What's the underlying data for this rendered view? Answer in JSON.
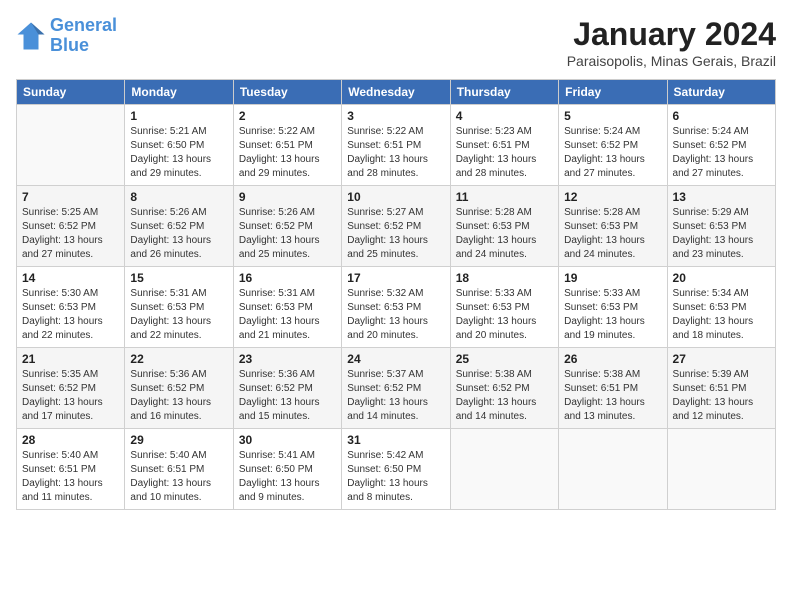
{
  "header": {
    "logo_line1": "General",
    "logo_line2": "Blue",
    "month": "January 2024",
    "location": "Paraisopolis, Minas Gerais, Brazil"
  },
  "weekdays": [
    "Sunday",
    "Monday",
    "Tuesday",
    "Wednesday",
    "Thursday",
    "Friday",
    "Saturday"
  ],
  "weeks": [
    [
      {
        "num": "",
        "empty": true
      },
      {
        "num": "1",
        "sunrise": "Sunrise: 5:21 AM",
        "sunset": "Sunset: 6:50 PM",
        "daylight": "Daylight: 13 hours and 29 minutes."
      },
      {
        "num": "2",
        "sunrise": "Sunrise: 5:22 AM",
        "sunset": "Sunset: 6:51 PM",
        "daylight": "Daylight: 13 hours and 29 minutes."
      },
      {
        "num": "3",
        "sunrise": "Sunrise: 5:22 AM",
        "sunset": "Sunset: 6:51 PM",
        "daylight": "Daylight: 13 hours and 28 minutes."
      },
      {
        "num": "4",
        "sunrise": "Sunrise: 5:23 AM",
        "sunset": "Sunset: 6:51 PM",
        "daylight": "Daylight: 13 hours and 28 minutes."
      },
      {
        "num": "5",
        "sunrise": "Sunrise: 5:24 AM",
        "sunset": "Sunset: 6:52 PM",
        "daylight": "Daylight: 13 hours and 27 minutes."
      },
      {
        "num": "6",
        "sunrise": "Sunrise: 5:24 AM",
        "sunset": "Sunset: 6:52 PM",
        "daylight": "Daylight: 13 hours and 27 minutes."
      }
    ],
    [
      {
        "num": "7",
        "sunrise": "Sunrise: 5:25 AM",
        "sunset": "Sunset: 6:52 PM",
        "daylight": "Daylight: 13 hours and 27 minutes."
      },
      {
        "num": "8",
        "sunrise": "Sunrise: 5:26 AM",
        "sunset": "Sunset: 6:52 PM",
        "daylight": "Daylight: 13 hours and 26 minutes."
      },
      {
        "num": "9",
        "sunrise": "Sunrise: 5:26 AM",
        "sunset": "Sunset: 6:52 PM",
        "daylight": "Daylight: 13 hours and 25 minutes."
      },
      {
        "num": "10",
        "sunrise": "Sunrise: 5:27 AM",
        "sunset": "Sunset: 6:52 PM",
        "daylight": "Daylight: 13 hours and 25 minutes."
      },
      {
        "num": "11",
        "sunrise": "Sunrise: 5:28 AM",
        "sunset": "Sunset: 6:53 PM",
        "daylight": "Daylight: 13 hours and 24 minutes."
      },
      {
        "num": "12",
        "sunrise": "Sunrise: 5:28 AM",
        "sunset": "Sunset: 6:53 PM",
        "daylight": "Daylight: 13 hours and 24 minutes."
      },
      {
        "num": "13",
        "sunrise": "Sunrise: 5:29 AM",
        "sunset": "Sunset: 6:53 PM",
        "daylight": "Daylight: 13 hours and 23 minutes."
      }
    ],
    [
      {
        "num": "14",
        "sunrise": "Sunrise: 5:30 AM",
        "sunset": "Sunset: 6:53 PM",
        "daylight": "Daylight: 13 hours and 22 minutes."
      },
      {
        "num": "15",
        "sunrise": "Sunrise: 5:31 AM",
        "sunset": "Sunset: 6:53 PM",
        "daylight": "Daylight: 13 hours and 22 minutes."
      },
      {
        "num": "16",
        "sunrise": "Sunrise: 5:31 AM",
        "sunset": "Sunset: 6:53 PM",
        "daylight": "Daylight: 13 hours and 21 minutes."
      },
      {
        "num": "17",
        "sunrise": "Sunrise: 5:32 AM",
        "sunset": "Sunset: 6:53 PM",
        "daylight": "Daylight: 13 hours and 20 minutes."
      },
      {
        "num": "18",
        "sunrise": "Sunrise: 5:33 AM",
        "sunset": "Sunset: 6:53 PM",
        "daylight": "Daylight: 13 hours and 20 minutes."
      },
      {
        "num": "19",
        "sunrise": "Sunrise: 5:33 AM",
        "sunset": "Sunset: 6:53 PM",
        "daylight": "Daylight: 13 hours and 19 minutes."
      },
      {
        "num": "20",
        "sunrise": "Sunrise: 5:34 AM",
        "sunset": "Sunset: 6:53 PM",
        "daylight": "Daylight: 13 hours and 18 minutes."
      }
    ],
    [
      {
        "num": "21",
        "sunrise": "Sunrise: 5:35 AM",
        "sunset": "Sunset: 6:52 PM",
        "daylight": "Daylight: 13 hours and 17 minutes."
      },
      {
        "num": "22",
        "sunrise": "Sunrise: 5:36 AM",
        "sunset": "Sunset: 6:52 PM",
        "daylight": "Daylight: 13 hours and 16 minutes."
      },
      {
        "num": "23",
        "sunrise": "Sunrise: 5:36 AM",
        "sunset": "Sunset: 6:52 PM",
        "daylight": "Daylight: 13 hours and 15 minutes."
      },
      {
        "num": "24",
        "sunrise": "Sunrise: 5:37 AM",
        "sunset": "Sunset: 6:52 PM",
        "daylight": "Daylight: 13 hours and 14 minutes."
      },
      {
        "num": "25",
        "sunrise": "Sunrise: 5:38 AM",
        "sunset": "Sunset: 6:52 PM",
        "daylight": "Daylight: 13 hours and 14 minutes."
      },
      {
        "num": "26",
        "sunrise": "Sunrise: 5:38 AM",
        "sunset": "Sunset: 6:51 PM",
        "daylight": "Daylight: 13 hours and 13 minutes."
      },
      {
        "num": "27",
        "sunrise": "Sunrise: 5:39 AM",
        "sunset": "Sunset: 6:51 PM",
        "daylight": "Daylight: 13 hours and 12 minutes."
      }
    ],
    [
      {
        "num": "28",
        "sunrise": "Sunrise: 5:40 AM",
        "sunset": "Sunset: 6:51 PM",
        "daylight": "Daylight: 13 hours and 11 minutes."
      },
      {
        "num": "29",
        "sunrise": "Sunrise: 5:40 AM",
        "sunset": "Sunset: 6:51 PM",
        "daylight": "Daylight: 13 hours and 10 minutes."
      },
      {
        "num": "30",
        "sunrise": "Sunrise: 5:41 AM",
        "sunset": "Sunset: 6:50 PM",
        "daylight": "Daylight: 13 hours and 9 minutes."
      },
      {
        "num": "31",
        "sunrise": "Sunrise: 5:42 AM",
        "sunset": "Sunset: 6:50 PM",
        "daylight": "Daylight: 13 hours and 8 minutes."
      },
      {
        "num": "",
        "empty": true
      },
      {
        "num": "",
        "empty": true
      },
      {
        "num": "",
        "empty": true
      }
    ]
  ]
}
